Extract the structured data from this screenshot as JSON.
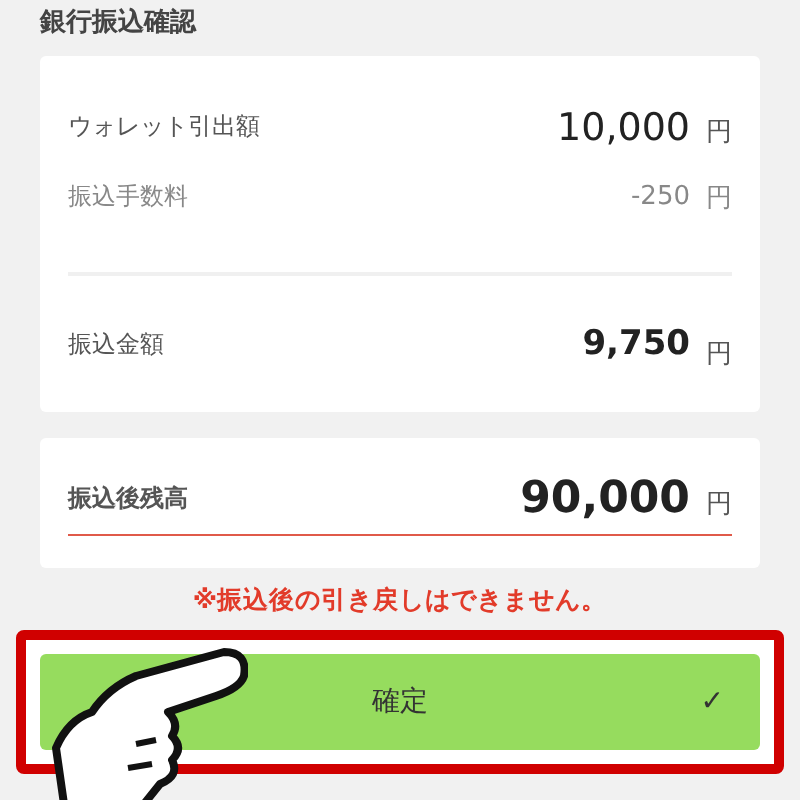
{
  "title": "銀行振込確認",
  "summary": {
    "rows": [
      {
        "kind": "amount",
        "label": "ウォレット引出額",
        "value": "10,000",
        "unit": "円"
      },
      {
        "kind": "fee",
        "label": "振込手数料",
        "value": "-250",
        "unit": "円"
      },
      {
        "kind": "total",
        "label": "振込金額",
        "value": "9,750",
        "unit": "円"
      }
    ]
  },
  "balance": {
    "label": "振込後残高",
    "value": "90,000",
    "unit": "円"
  },
  "warning": "※振込後の引き戻しはできません。",
  "confirm_button": {
    "label": "確定",
    "icon": "✓"
  }
}
